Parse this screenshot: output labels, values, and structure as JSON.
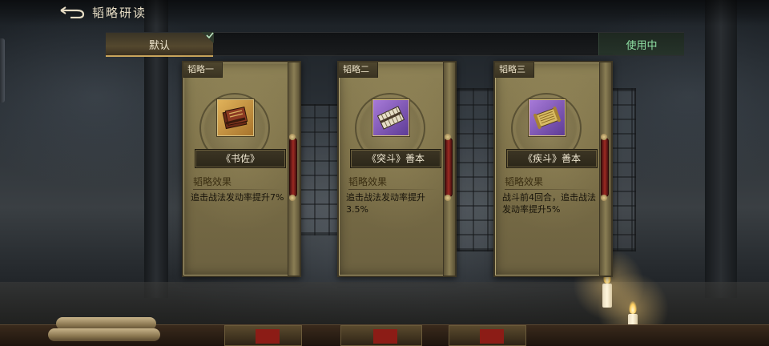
{
  "header": {
    "title": "韬略研读",
    "back_icon": "back-arrow-icon"
  },
  "tabs": {
    "default_label": "默认",
    "default_selected": true,
    "in_use_label": "使用中"
  },
  "colors": {
    "accent_gold": "#c9a55c",
    "in_use_green": "#8fe0a4",
    "card_bg": "#7c7048"
  },
  "cards": [
    {
      "slot_label": "韬略一",
      "item_name": "《书佐》",
      "item_rarity": "gold",
      "item_icon": "book-bundle-icon",
      "effect_title": "韬略效果",
      "effect_text": "追击战法发动率提升7%"
    },
    {
      "slot_label": "韬略二",
      "item_name": "《突斗》善本",
      "item_rarity": "purple",
      "item_icon": "bamboo-slips-icon",
      "effect_title": "韬略效果",
      "effect_text": "追击战法发动率提升3.5%"
    },
    {
      "slot_label": "韬略三",
      "item_name": "《疾斗》善本",
      "item_rarity": "purple",
      "item_icon": "scroll-bundle-icon",
      "effect_title": "韬略效果",
      "effect_text": "战斗前4回合，追击战法发动率提升5%"
    }
  ]
}
